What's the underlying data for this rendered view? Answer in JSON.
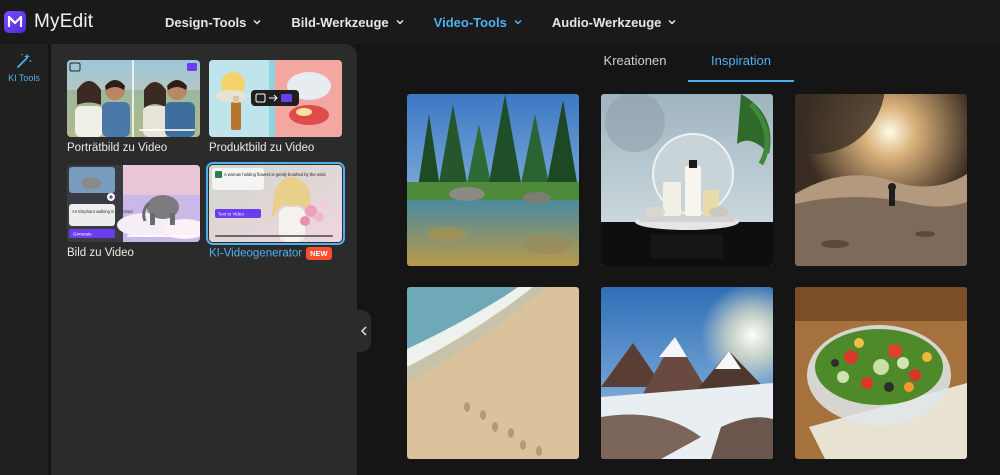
{
  "app": {
    "name": "MyEdit"
  },
  "nav": {
    "items": [
      {
        "label": "Design-Tools",
        "active": false
      },
      {
        "label": "Bild-Werkzeuge",
        "active": false
      },
      {
        "label": "Video-Tools",
        "active": true
      },
      {
        "label": "Audio-Werkzeuge",
        "active": false
      }
    ]
  },
  "rail": {
    "ki_tools_label": "KI Tools",
    "icon": "magic-wand-icon"
  },
  "panel": {
    "tools": [
      {
        "label": "Porträtbild zu Video"
      },
      {
        "label": "Produktbild zu Video"
      },
      {
        "label": "Bild zu Video",
        "prompt_text": "An Elephant walking in the cloud",
        "generate_label": "Generate"
      },
      {
        "label": "KI-Videogenerator",
        "badge": "NEW",
        "selected": true,
        "prompt_text": "A woman holding flowers is gently brushed by the wind",
        "button_label": "Text to Video"
      }
    ]
  },
  "main": {
    "tabs": [
      {
        "label": "Kreationen",
        "active": false
      },
      {
        "label": "Inspiration",
        "active": true
      }
    ],
    "gallery": [
      {
        "name": "gallery-forest-lake"
      },
      {
        "name": "gallery-cosmetics-product"
      },
      {
        "name": "gallery-astronaut-planet"
      },
      {
        "name": "gallery-beach-waves"
      },
      {
        "name": "gallery-snowy-mountains"
      },
      {
        "name": "gallery-salad-bowl"
      }
    ]
  },
  "colors": {
    "accent": "#4fb0f0",
    "badge": "#ff4d2e",
    "brand": "#6a3df0"
  }
}
